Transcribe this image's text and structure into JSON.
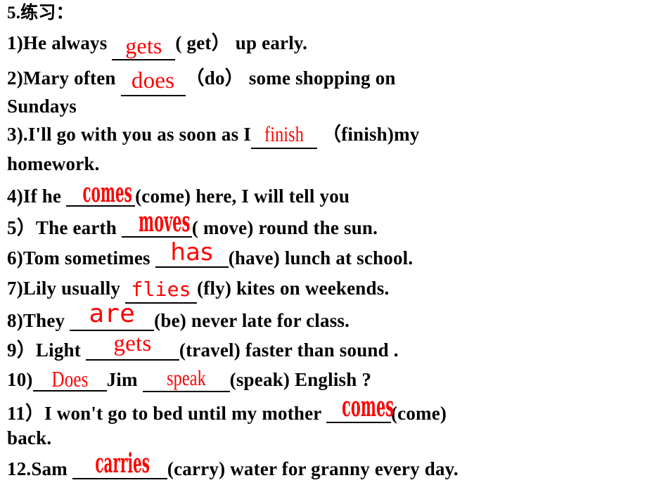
{
  "document": {
    "type": "worksheet-slide",
    "ink_color": "#ff0000",
    "text_color": "#000000",
    "background": "#ffffff",
    "heading": "5.练习："
  },
  "exercises": [
    {
      "id": "q1",
      "number": "1)",
      "before": "He always",
      "answer": "gets",
      "hint": "( get）",
      "after": "up  early.",
      "continuation": ""
    },
    {
      "id": "q2",
      "number": "2)",
      "before": "Mary often",
      "answer": "does",
      "hint": "（do）",
      "after": "some    shopping   on",
      "continuation": "Sundays"
    },
    {
      "id": "q3",
      "number": "3).",
      "before": "I'll go with  you  as   soon  as I",
      "answer": "finish",
      "hint": "（finish)",
      "after": "my",
      "continuation": "homework."
    },
    {
      "id": "q4",
      "number": "4)",
      "before": "If  he",
      "answer": "comes",
      "hint": "(come)",
      "after": "here,  I  will  tell you",
      "continuation": ""
    },
    {
      "id": "q5",
      "number": "5）",
      "before": "The   earth",
      "answer": "moves",
      "hint": "( move)",
      "after": "round   the    sun.",
      "continuation": ""
    },
    {
      "id": "q6",
      "number": "6)",
      "before": "Tom   sometimes",
      "answer": "has",
      "hint": "(have)",
      "after": "lunch   at   school.",
      "continuation": ""
    },
    {
      "id": "q7",
      "number": "7)",
      "before": "Lily   usually",
      "answer": "flies",
      "hint": "(fly)",
      "after": "kites on   weekends.",
      "continuation": ""
    },
    {
      "id": "q8",
      "number": "8)",
      "before": "They",
      "answer": "are",
      "hint": "(be)",
      "after": "never   late   for   class.",
      "continuation": ""
    },
    {
      "id": "q9",
      "number": "9）",
      "before": "Light",
      "answer": "gets",
      "hint": "(travel)",
      "after": "faster  than  sound  .",
      "continuation": ""
    },
    {
      "id": "q10",
      "number": "10)",
      "before": "",
      "answer": "Does",
      "mid": "Jim",
      "answer2": "speak",
      "hint": "(speak)",
      "after": "English ?",
      "continuation": ""
    },
    {
      "id": "q11",
      "number": "11）",
      "before": "I  won't go to   bed  until  my   mother",
      "answer": "comes",
      "hint": "(come)",
      "after": "",
      "continuation": "back."
    },
    {
      "id": "q12",
      "number": "12.",
      "before": "Sam",
      "answer": "carries",
      "hint": "(carry)",
      "after": "water   for   granny   every   day.",
      "continuation": ""
    }
  ]
}
